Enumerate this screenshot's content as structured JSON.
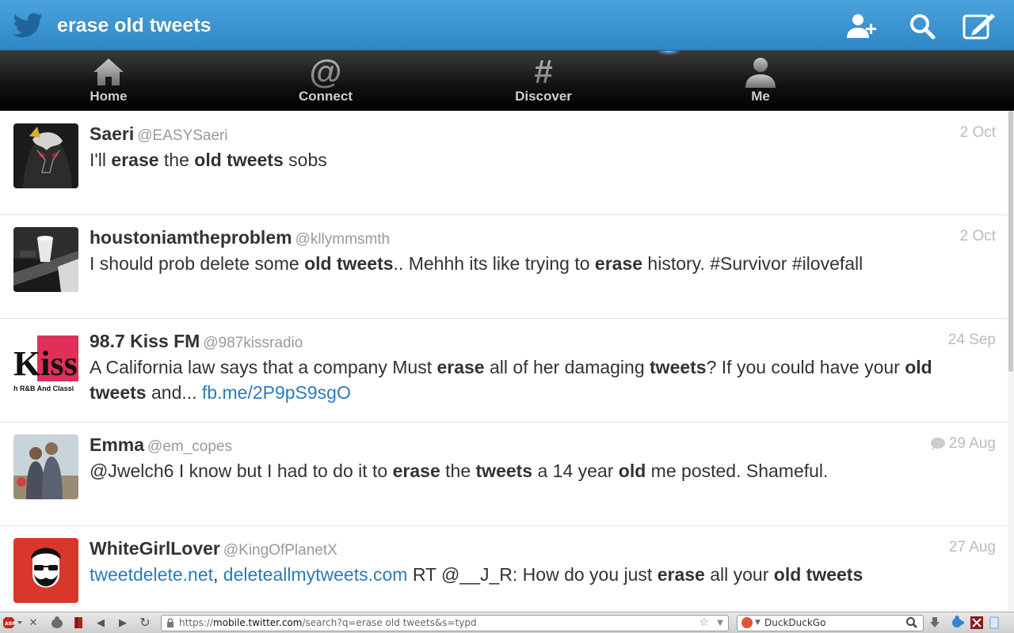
{
  "header": {
    "title": "erase old tweets"
  },
  "nav": {
    "items": [
      {
        "label": "Home",
        "icon": "home-icon"
      },
      {
        "label": "Connect",
        "icon": "at-icon"
      },
      {
        "label": "Discover",
        "icon": "hash-icon"
      },
      {
        "label": "Me",
        "icon": "person-icon"
      }
    ],
    "active_index": 3
  },
  "tweets": [
    {
      "name": "Saeri",
      "handle": "@EASYSaeri",
      "time": "2 Oct",
      "parts": [
        {
          "t": "I'll "
        },
        {
          "t": "erase",
          "b": true
        },
        {
          "t": " the "
        },
        {
          "t": "old tweets",
          "b": true
        },
        {
          "t": " sobs"
        }
      ],
      "avatar_colors": [
        "#1a1a1a",
        "#c8c8c8",
        "#7a0a0a"
      ]
    },
    {
      "name": "houstoniamtheproblem",
      "handle": "@kllymmsmth",
      "time": "2 Oct",
      "parts": [
        {
          "t": "I should prob delete some "
        },
        {
          "t": "old tweets",
          "b": true
        },
        {
          "t": ".. Mehhh its like trying to "
        },
        {
          "t": "erase",
          "b": true
        },
        {
          "t": " history. #Survivor #ilovefall"
        }
      ],
      "avatar_colors": [
        "#222222",
        "#dddddd",
        "#777777"
      ]
    },
    {
      "name": "98.7 Kiss FM",
      "handle": "@987kissradio",
      "time": "24 Sep",
      "parts": [
        {
          "t": "A California law says that a company Must "
        },
        {
          "t": "erase",
          "b": true
        },
        {
          "t": " all of her damaging "
        },
        {
          "t": "tweets",
          "b": true
        },
        {
          "t": "? If you could have your "
        },
        {
          "t": "old tweets",
          "b": true
        },
        {
          "t": " and... "
        },
        {
          "t": "fb.me/2P9pS9sgO",
          "link": true
        }
      ],
      "avatar_colors": [
        "#ffffff",
        "#e0305a",
        "#111111"
      ],
      "avatar_text": [
        "Kiss",
        "h R&B And Classi"
      ]
    },
    {
      "name": "Emma",
      "handle": "@em_copes",
      "time": "29 Aug",
      "has_reply_icon": true,
      "parts": [
        {
          "t": "@Jwelch6 I know but I had to do it to "
        },
        {
          "t": "erase",
          "b": true
        },
        {
          "t": " the "
        },
        {
          "t": "tweets",
          "b": true
        },
        {
          "t": " a 14 year "
        },
        {
          "t": "old",
          "b": true
        },
        {
          "t": " me posted. Shameful."
        }
      ],
      "avatar_colors": [
        "#c9d3da",
        "#4a4f5a",
        "#8a7a66"
      ]
    },
    {
      "name": "WhiteGirlLover",
      "handle": "@KingOfPlanetX",
      "time": "27 Aug",
      "parts": [
        {
          "t": "tweetdelete.net",
          "link": true
        },
        {
          "t": ", "
        },
        {
          "t": "deleteallmytweets.com",
          "link": true
        },
        {
          "t": " RT @__J_R: How do you just "
        },
        {
          "t": "erase",
          "b": true
        },
        {
          "t": " all your "
        },
        {
          "t": "old tweets",
          "b": true
        }
      ],
      "avatar_colors": [
        "#d9372c",
        "#111111",
        "#ffffff"
      ]
    }
  ],
  "browser": {
    "url_prefix": "https://",
    "url_domain": "mobile.twitter.com",
    "url_path": "/search?q=erase old tweets&s=typd",
    "search_engine": "DuckDuckGo"
  },
  "colors": {
    "accent_blue": "#2f86c6",
    "link": "#2b7bb9"
  }
}
